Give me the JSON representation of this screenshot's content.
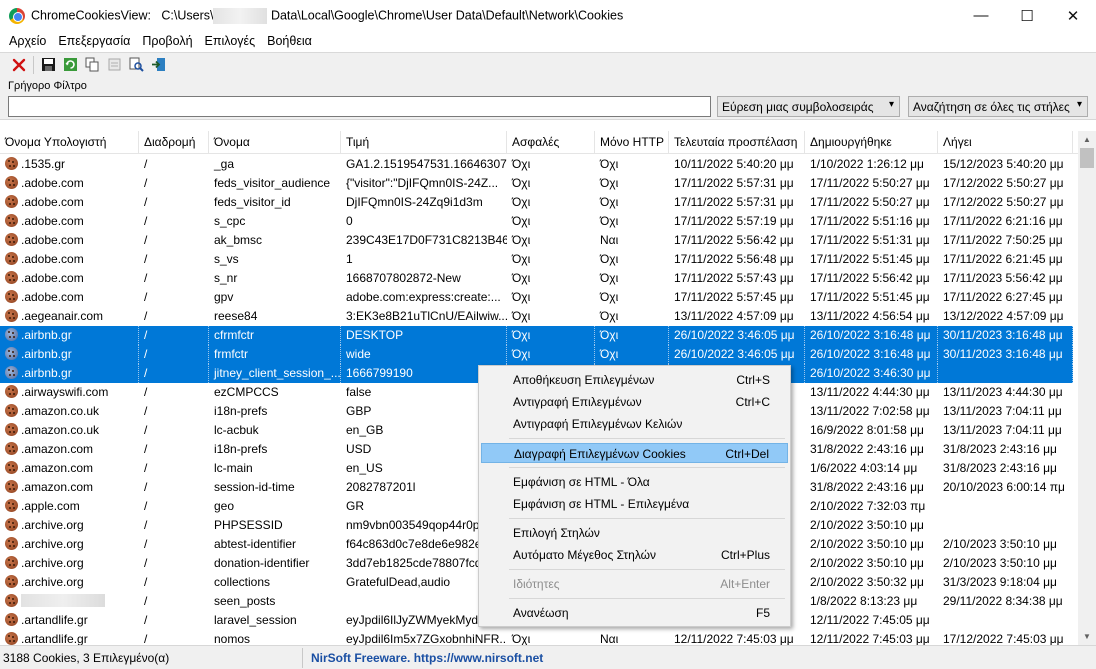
{
  "window": {
    "title_prefix": "ChromeCookiesView:   C:\\Users\\",
    "title_suffix": "Data\\Local\\Google\\Chrome\\User Data\\Default\\Network\\Cookies",
    "minimize": "—",
    "maximize": "☐",
    "close": "✕"
  },
  "menu": [
    "Αρχείο",
    "Επεξεργασία",
    "Προβολή",
    "Επιλογές",
    "Βοήθεια"
  ],
  "toolbar_icons": [
    "delete-icon",
    "save-icon",
    "refresh-icon",
    "copy-icon",
    "properties-icon",
    "find-icon",
    "exit-icon"
  ],
  "filter": {
    "label": "Γρήγορο Φίλτρο",
    "value": "",
    "mode": "Εύρεση μιας συμβολοσειράς",
    "scope": "Αναζήτηση σε όλες τις στήλες"
  },
  "columns": [
    "Όνομα Υπολογιστή",
    "Διαδρομή",
    "Όνομα",
    "Τιμή",
    "Ασφαλές",
    "Μόνο HTTP",
    "Τελευταία προσπέλαση",
    "Δημιουργήθηκε",
    "Λήγει"
  ],
  "sorted_column": 4,
  "rows": [
    {
      "host": ".1535.gr",
      "path": "/",
      "name": "_ga",
      "value": "GA1.2.1519547531.16646307...",
      "secure": "Όχι",
      "httponly": "Όχι",
      "last": "10/11/2022 5:40:20 μμ",
      "created": "1/10/2022 1:26:12 μμ",
      "expires": "15/12/2023 5:40:20 μμ"
    },
    {
      "host": ".adobe.com",
      "path": "/",
      "name": "feds_visitor_audience",
      "value": "{\"visitor\":\"DjIFQmn0IS-24Z...",
      "secure": "Όχι",
      "httponly": "Όχι",
      "last": "17/11/2022 5:57:31 μμ",
      "created": "17/11/2022 5:50:27 μμ",
      "expires": "17/12/2022 5:50:27 μμ"
    },
    {
      "host": ".adobe.com",
      "path": "/",
      "name": "feds_visitor_id",
      "value": "DjIFQmn0IS-24Zq9i1d3m",
      "secure": "Όχι",
      "httponly": "Όχι",
      "last": "17/11/2022 5:57:31 μμ",
      "created": "17/11/2022 5:50:27 μμ",
      "expires": "17/12/2022 5:50:27 μμ"
    },
    {
      "host": ".adobe.com",
      "path": "/",
      "name": "s_cpc",
      "value": "0",
      "secure": "Όχι",
      "httponly": "Όχι",
      "last": "17/11/2022 5:57:19 μμ",
      "created": "17/11/2022 5:51:16 μμ",
      "expires": "17/11/2022 6:21:16 μμ"
    },
    {
      "host": ".adobe.com",
      "path": "/",
      "name": "ak_bmsc",
      "value": "239C43E17D0F731C8213B46...",
      "secure": "Όχι",
      "httponly": "Ναι",
      "last": "17/11/2022 5:56:42 μμ",
      "created": "17/11/2022 5:51:31 μμ",
      "expires": "17/11/2022 7:50:25 μμ"
    },
    {
      "host": ".adobe.com",
      "path": "/",
      "name": "s_vs",
      "value": "1",
      "secure": "Όχι",
      "httponly": "Όχι",
      "last": "17/11/2022 5:56:48 μμ",
      "created": "17/11/2022 5:51:45 μμ",
      "expires": "17/11/2022 6:21:45 μμ"
    },
    {
      "host": ".adobe.com",
      "path": "/",
      "name": "s_nr",
      "value": "1668707802872-New",
      "secure": "Όχι",
      "httponly": "Όχι",
      "last": "17/11/2022 5:57:43 μμ",
      "created": "17/11/2022 5:56:42 μμ",
      "expires": "17/11/2023 5:56:42 μμ"
    },
    {
      "host": ".adobe.com",
      "path": "/",
      "name": "gpv",
      "value": "adobe.com:express:create:...",
      "secure": "Όχι",
      "httponly": "Όχι",
      "last": "17/11/2022 5:57:45 μμ",
      "created": "17/11/2022 5:51:45 μμ",
      "expires": "17/11/2022 6:27:45 μμ"
    },
    {
      "host": ".aegeanair.com",
      "path": "/",
      "name": "reese84",
      "value": "3:EK3e8B21uTlCnU/EAilwiw...",
      "secure": "Όχι",
      "httponly": "Όχι",
      "last": "13/11/2022 4:57:09 μμ",
      "created": "13/11/2022 4:56:54 μμ",
      "expires": "13/12/2022 4:57:09 μμ"
    },
    {
      "host": ".airbnb.gr",
      "path": "/",
      "name": "cfrmfctr",
      "value": "DESKTOP",
      "secure": "Όχι",
      "httponly": "Όχι",
      "last": "26/10/2022 3:46:05 μμ",
      "created": "26/10/2022 3:16:48 μμ",
      "expires": "30/11/2023 3:16:48 μμ",
      "selected": true
    },
    {
      "host": ".airbnb.gr",
      "path": "/",
      "name": "frmfctr",
      "value": "wide",
      "secure": "Όχι",
      "httponly": "Όχι",
      "last": "26/10/2022 3:46:05 μμ",
      "created": "26/10/2022 3:16:48 μμ",
      "expires": "30/11/2023 3:16:48 μμ",
      "selected": true
    },
    {
      "host": ".airbnb.gr",
      "path": "/",
      "name": "jitney_client_session_...",
      "value": "1666799190",
      "secure": "",
      "httponly": "",
      "last": "",
      "created": "26/10/2022 3:46:30 μμ",
      "expires": "",
      "selected": true
    },
    {
      "host": ".airwayswifi.com",
      "path": "/",
      "name": "ezCMPCCS",
      "value": "false",
      "secure": "",
      "httponly": "",
      "last": "",
      "created": "13/11/2022 4:44:30 μμ",
      "expires": "13/11/2023 4:44:30 μμ"
    },
    {
      "host": ".amazon.co.uk",
      "path": "/",
      "name": "i18n-prefs",
      "value": "GBP",
      "secure": "",
      "httponly": "",
      "last": "",
      "created": "13/11/2022 7:02:58 μμ",
      "expires": "13/11/2023 7:04:11 μμ"
    },
    {
      "host": ".amazon.co.uk",
      "path": "/",
      "name": "lc-acbuk",
      "value": "en_GB",
      "secure": "",
      "httponly": "",
      "last": "",
      "created": "16/9/2022 8:01:58 μμ",
      "expires": "13/11/2023 7:04:11 μμ"
    },
    {
      "host": ".amazon.com",
      "path": "/",
      "name": "i18n-prefs",
      "value": "USD",
      "secure": "",
      "httponly": "",
      "last": "",
      "created": "31/8/2022 2:43:16 μμ",
      "expires": "31/8/2023 2:43:16 μμ"
    },
    {
      "host": ".amazon.com",
      "path": "/",
      "name": "lc-main",
      "value": "en_US",
      "secure": "",
      "httponly": "",
      "last": "",
      "created": "1/6/2022 4:03:14 μμ",
      "expires": "31/8/2023 2:43:16 μμ"
    },
    {
      "host": ".amazon.com",
      "path": "/",
      "name": "session-id-time",
      "value": "2082787201l",
      "secure": "",
      "httponly": "",
      "last": "",
      "created": "31/8/2022 2:43:16 μμ",
      "expires": "20/10/2023 6:00:14 πμ"
    },
    {
      "host": ".apple.com",
      "path": "/",
      "name": "geo",
      "value": "GR",
      "secure": "",
      "httponly": "",
      "last": "",
      "created": "2/10/2022 7:32:03 πμ",
      "expires": ""
    },
    {
      "host": ".archive.org",
      "path": "/",
      "name": "PHPSESSID",
      "value": "nm9vbn003549qop44r0p...",
      "secure": "",
      "httponly": "",
      "last": "",
      "created": "2/10/2022 3:50:10 μμ",
      "expires": ""
    },
    {
      "host": ".archive.org",
      "path": "/",
      "name": "abtest-identifier",
      "value": "f64c863d0c7e8de6e982e1...",
      "secure": "",
      "httponly": "",
      "last": "",
      "created": "2/10/2022 3:50:10 μμ",
      "expires": "2/10/2023 3:50:10 μμ"
    },
    {
      "host": ".archive.org",
      "path": "/",
      "name": "donation-identifier",
      "value": "3dd7eb1825cde78807fcd9...",
      "secure": "",
      "httponly": "",
      "last": "",
      "created": "2/10/2022 3:50:10 μμ",
      "expires": "2/10/2023 3:50:10 μμ"
    },
    {
      "host": ".archive.org",
      "path": "/",
      "name": "collections",
      "value": "GratefulDead,audio",
      "secure": "",
      "httponly": "",
      "last": "",
      "created": "2/10/2022 3:50:32 μμ",
      "expires": "31/3/2023 9:18:04 μμ"
    },
    {
      "host": "",
      "path": "/",
      "name": "seen_posts",
      "value": "",
      "secure": "",
      "httponly": "",
      "last": "",
      "created": "1/8/2022 8:13:23 μμ",
      "expires": "29/11/2022 8:34:38 μμ",
      "blurred_host": true
    },
    {
      "host": ".artandlife.gr",
      "path": "/",
      "name": "laravel_session",
      "value": "eyJpdil6IlJyZWMyekMydC...",
      "secure": "",
      "httponly": "",
      "last": "",
      "created": "12/11/2022 7:45:05 μμ",
      "expires": ""
    },
    {
      "host": ".artandlife.gr",
      "path": "/",
      "name": "nomos",
      "value": "eyJpdil6Im5x7ZGxobnhiNFR...",
      "secure": "Όχι",
      "httponly": "Ναι",
      "last": "12/11/2022 7:45:03 μμ",
      "created": "12/11/2022 7:45:03 μμ",
      "expires": "17/12/2022 7:45:03 μμ"
    }
  ],
  "context_menu": [
    {
      "label": "Αποθήκευση Επιλεγμένων",
      "shortcut": "Ctrl+S"
    },
    {
      "label": "Αντιγραφή Επιλεγμένων",
      "shortcut": "Ctrl+C"
    },
    {
      "label": "Αντιγραφή Επιλεγμένων Κελιών",
      "shortcut": ""
    },
    {
      "label": "Διαγραφή Επιλεγμένων Cookies",
      "shortcut": "Ctrl+Del",
      "highlighted": true
    },
    {
      "label": "Εμφάνιση σε HTML - Όλα",
      "shortcut": ""
    },
    {
      "label": "Εμφάνιση σε HTML - Επιλεγμένα",
      "shortcut": ""
    },
    {
      "label": "Επιλογή Στηλών",
      "shortcut": ""
    },
    {
      "label": "Αυτόματο Μέγεθος Στηλών",
      "shortcut": "Ctrl+Plus"
    },
    {
      "label": "Ιδιότητες",
      "shortcut": "Alt+Enter",
      "disabled": true
    },
    {
      "label": "Ανανέωση",
      "shortcut": "F5"
    }
  ],
  "status": {
    "count": "3188 Cookies, 3 Επιλεγμένο(α)",
    "credit": "NirSoft Freeware. https://www.nirsoft.net"
  }
}
